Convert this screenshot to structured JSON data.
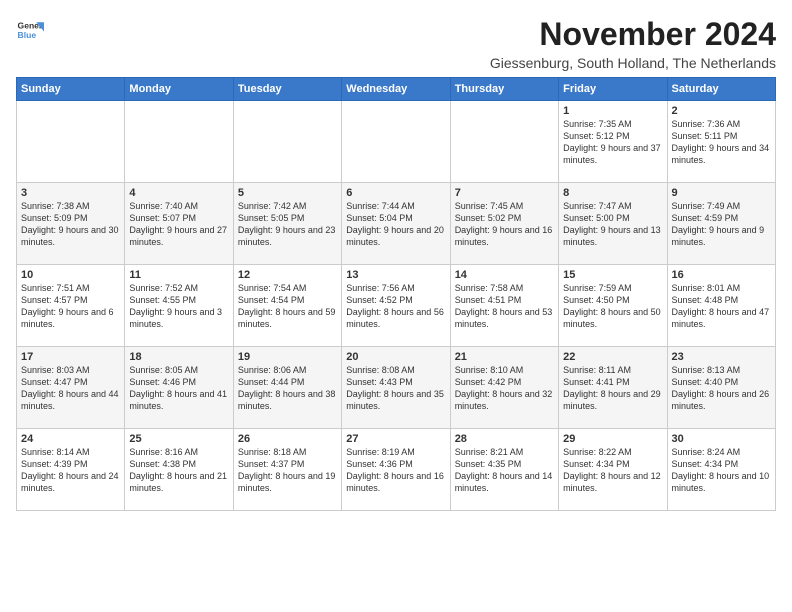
{
  "logo": {
    "line1": "General",
    "line2": "Blue"
  },
  "title": "November 2024",
  "location": "Giessenburg, South Holland, The Netherlands",
  "weekdays": [
    "Sunday",
    "Monday",
    "Tuesday",
    "Wednesday",
    "Thursday",
    "Friday",
    "Saturday"
  ],
  "weeks": [
    [
      {
        "day": "",
        "info": ""
      },
      {
        "day": "",
        "info": ""
      },
      {
        "day": "",
        "info": ""
      },
      {
        "day": "",
        "info": ""
      },
      {
        "day": "",
        "info": ""
      },
      {
        "day": "1",
        "info": "Sunrise: 7:35 AM\nSunset: 5:12 PM\nDaylight: 9 hours and 37 minutes."
      },
      {
        "day": "2",
        "info": "Sunrise: 7:36 AM\nSunset: 5:11 PM\nDaylight: 9 hours and 34 minutes."
      }
    ],
    [
      {
        "day": "3",
        "info": "Sunrise: 7:38 AM\nSunset: 5:09 PM\nDaylight: 9 hours and 30 minutes."
      },
      {
        "day": "4",
        "info": "Sunrise: 7:40 AM\nSunset: 5:07 PM\nDaylight: 9 hours and 27 minutes."
      },
      {
        "day": "5",
        "info": "Sunrise: 7:42 AM\nSunset: 5:05 PM\nDaylight: 9 hours and 23 minutes."
      },
      {
        "day": "6",
        "info": "Sunrise: 7:44 AM\nSunset: 5:04 PM\nDaylight: 9 hours and 20 minutes."
      },
      {
        "day": "7",
        "info": "Sunrise: 7:45 AM\nSunset: 5:02 PM\nDaylight: 9 hours and 16 minutes."
      },
      {
        "day": "8",
        "info": "Sunrise: 7:47 AM\nSunset: 5:00 PM\nDaylight: 9 hours and 13 minutes."
      },
      {
        "day": "9",
        "info": "Sunrise: 7:49 AM\nSunset: 4:59 PM\nDaylight: 9 hours and 9 minutes."
      }
    ],
    [
      {
        "day": "10",
        "info": "Sunrise: 7:51 AM\nSunset: 4:57 PM\nDaylight: 9 hours and 6 minutes."
      },
      {
        "day": "11",
        "info": "Sunrise: 7:52 AM\nSunset: 4:55 PM\nDaylight: 9 hours and 3 minutes."
      },
      {
        "day": "12",
        "info": "Sunrise: 7:54 AM\nSunset: 4:54 PM\nDaylight: 8 hours and 59 minutes."
      },
      {
        "day": "13",
        "info": "Sunrise: 7:56 AM\nSunset: 4:52 PM\nDaylight: 8 hours and 56 minutes."
      },
      {
        "day": "14",
        "info": "Sunrise: 7:58 AM\nSunset: 4:51 PM\nDaylight: 8 hours and 53 minutes."
      },
      {
        "day": "15",
        "info": "Sunrise: 7:59 AM\nSunset: 4:50 PM\nDaylight: 8 hours and 50 minutes."
      },
      {
        "day": "16",
        "info": "Sunrise: 8:01 AM\nSunset: 4:48 PM\nDaylight: 8 hours and 47 minutes."
      }
    ],
    [
      {
        "day": "17",
        "info": "Sunrise: 8:03 AM\nSunset: 4:47 PM\nDaylight: 8 hours and 44 minutes."
      },
      {
        "day": "18",
        "info": "Sunrise: 8:05 AM\nSunset: 4:46 PM\nDaylight: 8 hours and 41 minutes."
      },
      {
        "day": "19",
        "info": "Sunrise: 8:06 AM\nSunset: 4:44 PM\nDaylight: 8 hours and 38 minutes."
      },
      {
        "day": "20",
        "info": "Sunrise: 8:08 AM\nSunset: 4:43 PM\nDaylight: 8 hours and 35 minutes."
      },
      {
        "day": "21",
        "info": "Sunrise: 8:10 AM\nSunset: 4:42 PM\nDaylight: 8 hours and 32 minutes."
      },
      {
        "day": "22",
        "info": "Sunrise: 8:11 AM\nSunset: 4:41 PM\nDaylight: 8 hours and 29 minutes."
      },
      {
        "day": "23",
        "info": "Sunrise: 8:13 AM\nSunset: 4:40 PM\nDaylight: 8 hours and 26 minutes."
      }
    ],
    [
      {
        "day": "24",
        "info": "Sunrise: 8:14 AM\nSunset: 4:39 PM\nDaylight: 8 hours and 24 minutes."
      },
      {
        "day": "25",
        "info": "Sunrise: 8:16 AM\nSunset: 4:38 PM\nDaylight: 8 hours and 21 minutes."
      },
      {
        "day": "26",
        "info": "Sunrise: 8:18 AM\nSunset: 4:37 PM\nDaylight: 8 hours and 19 minutes."
      },
      {
        "day": "27",
        "info": "Sunrise: 8:19 AM\nSunset: 4:36 PM\nDaylight: 8 hours and 16 minutes."
      },
      {
        "day": "28",
        "info": "Sunrise: 8:21 AM\nSunset: 4:35 PM\nDaylight: 8 hours and 14 minutes."
      },
      {
        "day": "29",
        "info": "Sunrise: 8:22 AM\nSunset: 4:34 PM\nDaylight: 8 hours and 12 minutes."
      },
      {
        "day": "30",
        "info": "Sunrise: 8:24 AM\nSunset: 4:34 PM\nDaylight: 8 hours and 10 minutes."
      }
    ]
  ]
}
